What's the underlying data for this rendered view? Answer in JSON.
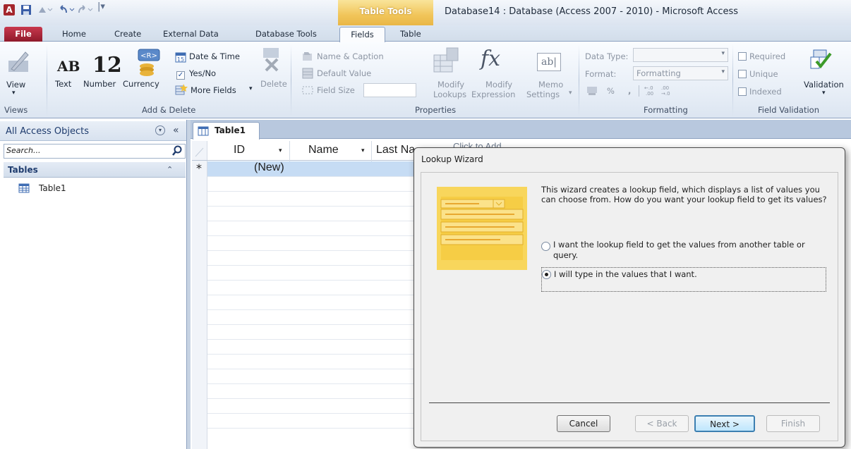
{
  "window": {
    "title": "Database14 : Database (Access 2007 - 2010)  -  Microsoft Access",
    "app_icon": "A",
    "context_tab_group": "Table Tools"
  },
  "tabs": {
    "file": "File",
    "home": "Home",
    "create": "Create",
    "external_data": "External Data",
    "database_tools": "Database Tools",
    "fields": "Fields",
    "table": "Table"
  },
  "ribbon": {
    "views": {
      "view_label": "View",
      "group": "Views"
    },
    "add_delete": {
      "text_label": "Text",
      "number_label": "Number",
      "currency_label": "Currency",
      "date_time": "Date & Time",
      "yes_no": "Yes/No",
      "more_fields": "More Fields",
      "delete": "Delete",
      "group": "Add & Delete",
      "text_icon": "AB",
      "number_icon": "12"
    },
    "properties": {
      "name_caption": "Name & Caption",
      "default_value": "Default Value",
      "field_size": "Field Size",
      "modify_lookups_1": "Modify",
      "modify_lookups_2": "Lookups",
      "modify_expression_1": "Modify",
      "modify_expression_2": "Expression",
      "memo_settings_1": "Memo",
      "memo_settings_2": "Settings",
      "group": "Properties"
    },
    "formatting": {
      "data_type_label": "Data Type:",
      "data_type_value": "",
      "format_label": "Format:",
      "format_value": "Formatting",
      "percent": "%",
      "comma": ",",
      "group": "Formatting"
    },
    "validation": {
      "required": "Required",
      "unique": "Unique",
      "indexed": "Indexed",
      "validation": "Validation",
      "group": "Field Validation"
    }
  },
  "nav_pane": {
    "title": "All Access Objects",
    "search_placeholder": "Search...",
    "section": "Tables",
    "items": [
      "Table1"
    ]
  },
  "datasheet": {
    "tab": "Table1",
    "columns": [
      "ID",
      "Name",
      "Last Na",
      "Click to Add"
    ],
    "new_row_marker": "*",
    "new_row_id": "(New)"
  },
  "dialog": {
    "title": "Lookup Wizard",
    "description": "This wizard creates a lookup field, which displays a list of values you can choose from.  How do you want your lookup field to get its values?",
    "option1": "I want the lookup field to get the values from another table or query.",
    "option2": "I will type in the values that I want.",
    "selected_option": 2,
    "buttons": {
      "cancel": "Cancel",
      "back": "< Back",
      "next": "Next >",
      "finish": "Finish"
    }
  },
  "colors": {
    "file_tab": "#b32c3f",
    "context_tab": "#f1c55a",
    "selected_row": "#c6dcf4",
    "ribbon_bg": "#e6edf6"
  }
}
